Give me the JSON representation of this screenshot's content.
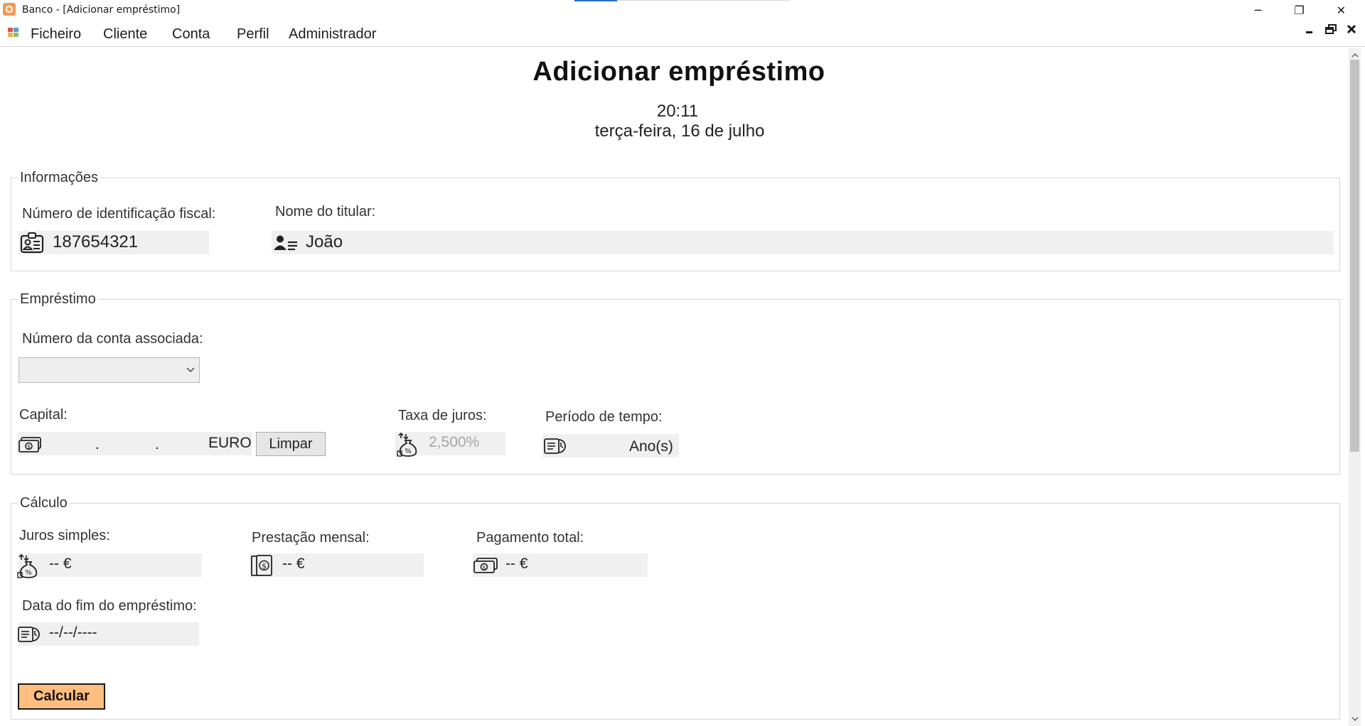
{
  "window": {
    "title": "Banco - [Adicionar empréstimo]",
    "controls": {
      "minimize": "─",
      "restore": "❐",
      "close": "✕"
    }
  },
  "menu": {
    "items": [
      "Ficheiro",
      "Cliente",
      "Conta",
      "Perfil",
      "Administrador"
    ],
    "mdi_controls": {
      "minimize": "▁",
      "restore": "🗗",
      "close": "✕"
    }
  },
  "page": {
    "title": "Adicionar empréstimo",
    "time": "20:11",
    "date": "terça-feira, 16 de julho"
  },
  "informacoes": {
    "legend": "Informações",
    "nif_label": "Número de identificação fiscal:",
    "nif_value": "187654321",
    "nome_label": "Nome do titular:",
    "nome_value": "João"
  },
  "emprestimo": {
    "legend": "Empréstimo",
    "conta_label": "Número da conta associada:",
    "conta_selected": "",
    "capital_label": "Capital:",
    "capital_dot1": ".",
    "capital_dot2": ".",
    "capital_currency": "EURO",
    "limpar_label": "Limpar",
    "taxa_label": "Taxa de juros:",
    "taxa_placeholder": "2,500%",
    "periodo_label": "Período de tempo:",
    "periodo_unit": "Ano(s)"
  },
  "calculo": {
    "legend": "Cálculo",
    "juros_label": "Juros simples:",
    "juros_value": "-- €",
    "prestacao_label": "Prestação mensal:",
    "prestacao_value": "-- €",
    "pagamento_label": "Pagamento total:",
    "pagamento_value": "-- €",
    "data_fim_label": "Data do fim do empréstimo:",
    "data_fim_value": "--/--/----",
    "calcular_label": "Calcular"
  },
  "colors": {
    "calcular_bg": "#ffbe7f",
    "field_bg": "#f0f0f0",
    "app_icon": "#f29a57"
  },
  "icons": {
    "app": "bank-app-icon",
    "nif": "id-card-icon",
    "nome": "user-list-icon",
    "capital": "banknote-icon",
    "taxa": "money-bag-percent-icon",
    "periodo": "calendar-clock-icon",
    "juros": "money-bag-percent-icon",
    "prestacao": "dollar-book-icon",
    "pagamento": "banknote-icon",
    "data_fim": "calendar-clock-icon"
  }
}
